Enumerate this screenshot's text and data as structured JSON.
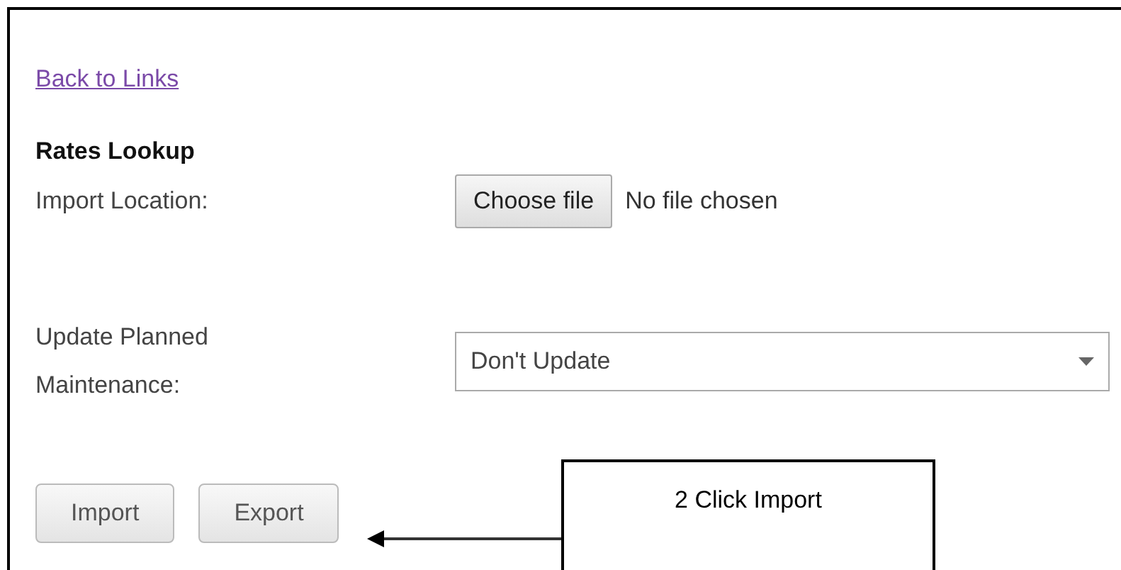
{
  "back_link": "Back to Links",
  "heading": "Rates Lookup",
  "import_location": {
    "label": "Import Location:",
    "button": "Choose file",
    "status": "No file chosen"
  },
  "update_planned": {
    "label_lines": [
      "Update Planned",
      "Maintenance:"
    ],
    "value": "Don't Update"
  },
  "buttons": [
    "Import",
    "Export"
  ],
  "callout": {
    "text": "2 Click Import"
  }
}
